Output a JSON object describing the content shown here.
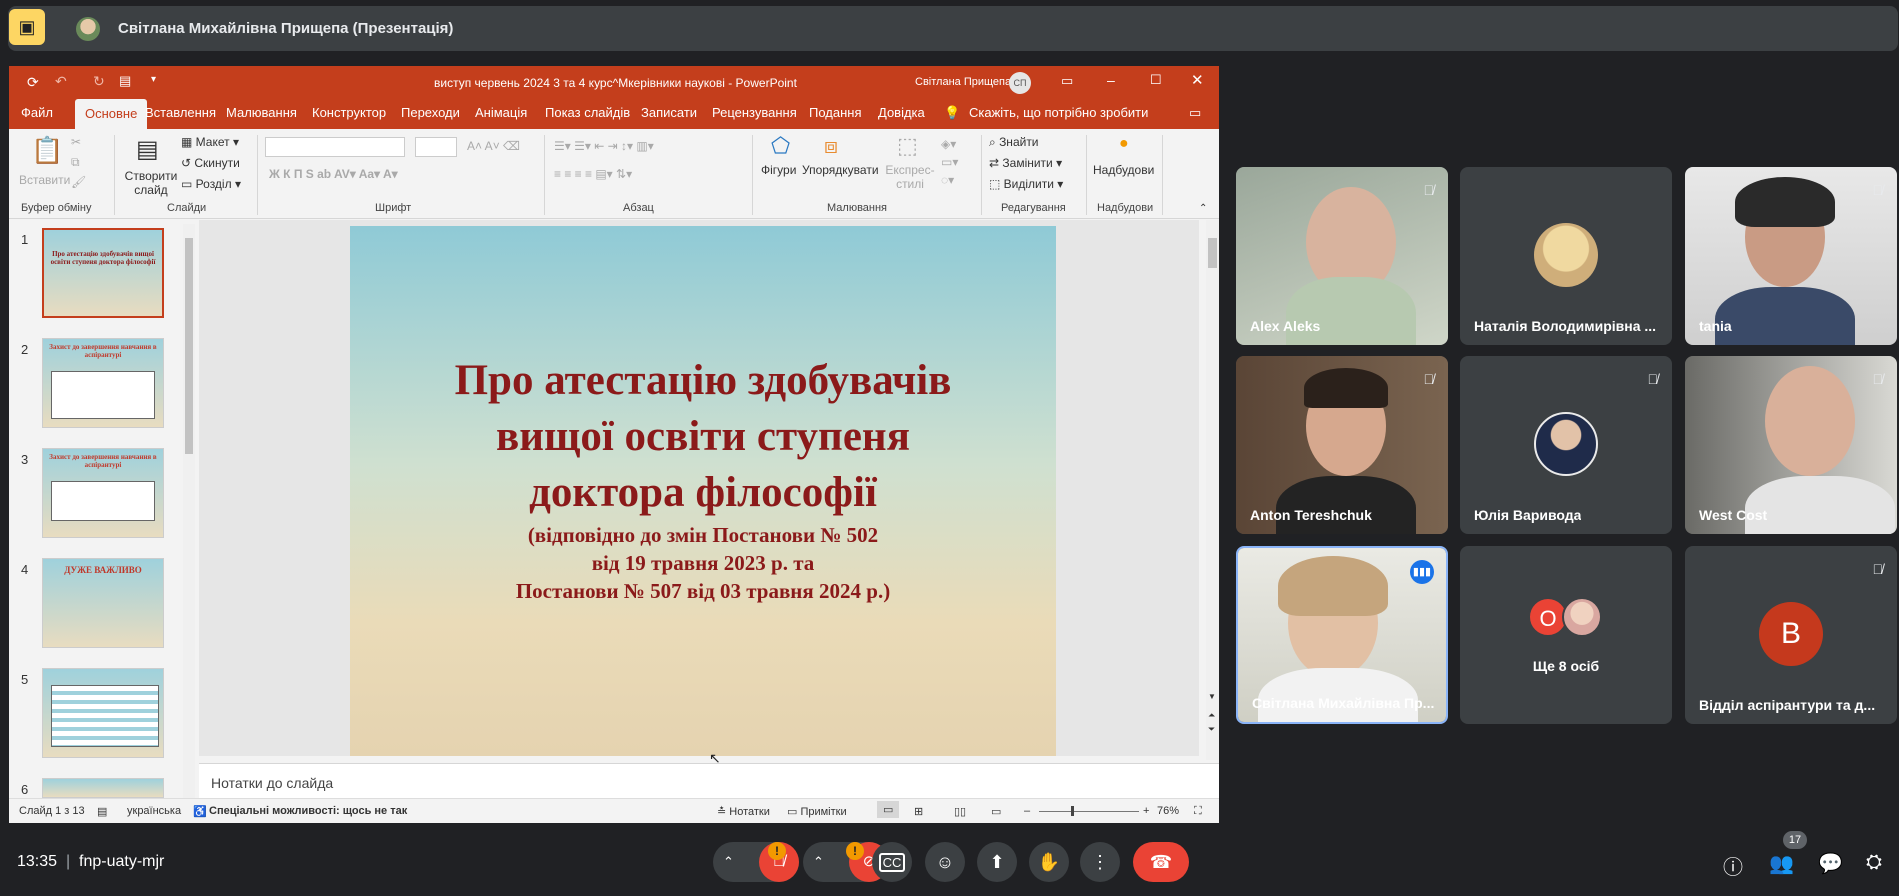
{
  "topbar": {
    "presenter": "Світлана Михайлівна Прищепа (Презентація)"
  },
  "ppt": {
    "doc_title": "виступ червень 2024 3 та 4 курс^Мкерівники наукові  -  PowerPoint",
    "user": "Світлана Прищепа",
    "user_initials": "СП",
    "tabs": [
      "Файл",
      "Основне",
      "Вставлення",
      "Малювання",
      "Конструктор",
      "Переходи",
      "Анімація",
      "Показ слайдів",
      "Записати",
      "Рецензування",
      "Подання",
      "Довідка"
    ],
    "tell_me": "Скажіть, що потрібно зробити",
    "ribbon": {
      "paste": "Вставити",
      "new_slide": "Створити слайд",
      "layout": "Макет",
      "reset": "Скинути",
      "section": "Розділ",
      "shapes": "Фігури",
      "arrange": "Упорядкувати",
      "quick_styles": "Експрес-стилі",
      "find": "Знайти",
      "replace": "Замінити",
      "select": "Виділити",
      "addins": "Надбудови",
      "groups": {
        "clipboard": "Буфер обміну",
        "slides": "Слайди",
        "font": "Шрифт",
        "paragraph": "Абзац",
        "drawing": "Малювання",
        "editing": "Редагування",
        "addins": "Надбудови"
      }
    },
    "thumbnails": [
      {
        "num": "1",
        "title": "Про атестацію здобувачів вищої освіти ступеня доктора філософії"
      },
      {
        "num": "2",
        "title": "Захист до завершення навчання в аспірантурі"
      },
      {
        "num": "3",
        "title": "Захист до завершення навчання в аспірантурі"
      },
      {
        "num": "4",
        "title": "ДУЖЕ ВАЖЛИВО"
      },
      {
        "num": "5",
        "title": ""
      },
      {
        "num": "6",
        "title": ""
      }
    ],
    "slide": {
      "title_l1": "Про атестацію здобувачів",
      "title_l2": "вищої освіти ступеня",
      "title_l3": "доктора філософії",
      "sub_l1": "(відповідно до змін Постанови № 502",
      "sub_l2": "від 19 травня 2023 р. та",
      "sub_l3": "Постанови № 507 від 03 травня 2024 р.)"
    },
    "notes_placeholder": "Нотатки до слайда",
    "status": {
      "slide_of": "Слайд 1 з 13",
      "language": "українська",
      "accessibility": "Спеціальні можливості: щось не так",
      "notes": "Нотатки",
      "comments": "Примітки",
      "zoom": "76%"
    }
  },
  "participants": [
    {
      "name": "Alex Aleks"
    },
    {
      "name": "Наталія Володимирівна ..."
    },
    {
      "name": "tania"
    },
    {
      "name": "Anton Tereshchuk"
    },
    {
      "name": "Юлія Варивода"
    },
    {
      "name": "West Cost"
    },
    {
      "name": "Світлана Михайлівна Пр..."
    },
    {
      "name": "Ще 8 осіб",
      "avatar_letter": "О"
    },
    {
      "name": "Відділ аспірантури та д...",
      "avatar_letter": "В"
    }
  ],
  "bottom": {
    "time": "13:35",
    "meeting_code": "fnp-uaty-mjr",
    "people_count": "17",
    "warning_badge": "!"
  },
  "colors": {
    "ppt_accent": "#c43e1c",
    "end_call": "#ea4335",
    "warning": "#f29900",
    "speaking_border": "#8ab4f8"
  }
}
